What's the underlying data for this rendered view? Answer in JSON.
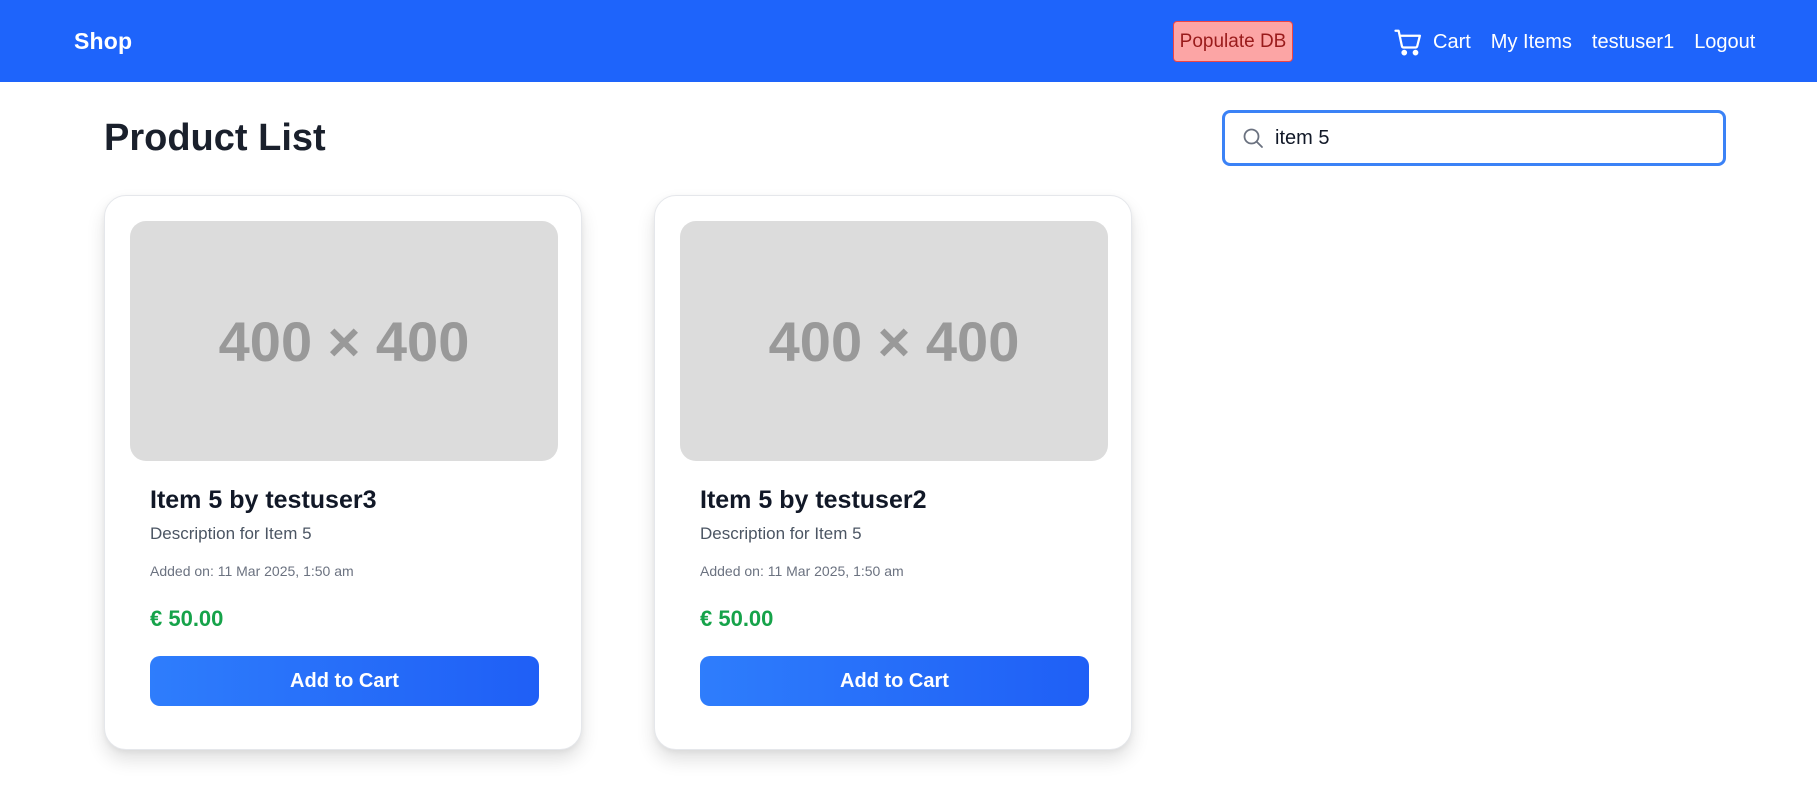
{
  "navbar": {
    "brand": "Shop",
    "populate_label": "Populate DB",
    "cart_label": "Cart",
    "my_items_label": "My Items",
    "username": "testuser1",
    "logout_label": "Logout",
    "cart_icon": "cart-icon",
    "bg_color": "#1e64fb"
  },
  "main": {
    "title": "Product List",
    "search": {
      "value": "item 5",
      "icon": "search-icon"
    }
  },
  "products": [
    {
      "image_text": "400 × 400",
      "title": "Item 5 by testuser3",
      "description": "Description for Item 5",
      "added_on": "Added on: 11 Mar 2025, 1:50 am",
      "price": "€ 50.00",
      "button_label": "Add to Cart"
    },
    {
      "image_text": "400 × 400",
      "title": "Item 5 by testuser2",
      "description": "Description for Item 5",
      "added_on": "Added on: 11 Mar 2025, 1:50 am",
      "price": "€ 50.00",
      "button_label": "Add to Cart"
    }
  ],
  "colors": {
    "accent": "#1e64fb",
    "price": "#16a34a",
    "populate_bg": "#fca5a5",
    "populate_text": "#991b1b"
  }
}
